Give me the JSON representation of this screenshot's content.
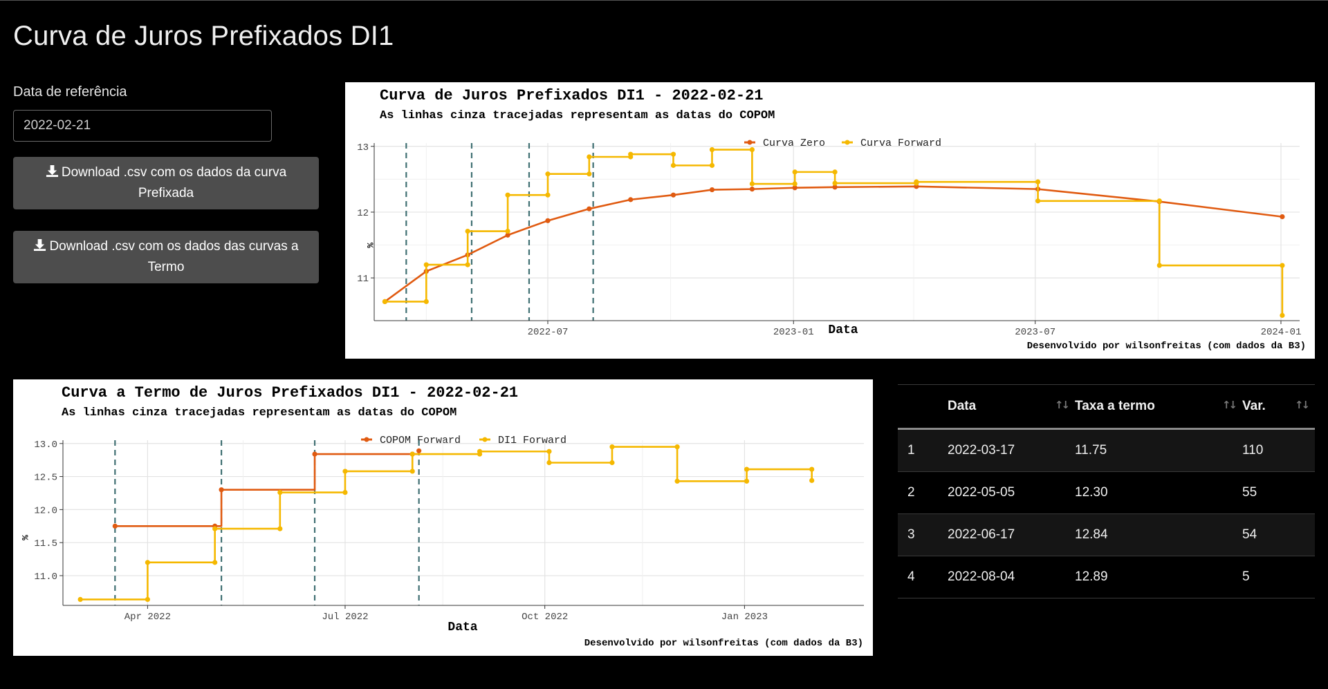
{
  "page": {
    "title": "Curva de Juros Prefixados DI1"
  },
  "sidebar": {
    "ref_label": "Data de referência",
    "ref_date_value": "2022-02-21",
    "download_curve_label": "Download .csv com os dados da curva Prefixada",
    "download_forward_label": "Download .csv com os dados das curvas a Termo"
  },
  "plot1": {
    "title": "Curva de Juros Prefixados DI1 - 2022-02-21",
    "subtitle": "As linhas cinza tracejadas representam as datas do COPOM",
    "legend": [
      "Curva Zero",
      "Curva Forward"
    ],
    "xlabel": "Data",
    "ylabel": "%",
    "caption": "Desenvolvido por wilsonfreitas (com dados da B3)",
    "xticks": [
      "2022-07",
      "2023-01",
      "2023-07",
      "2024-01"
    ],
    "yticks": [
      "11",
      "12",
      "13"
    ]
  },
  "plot2": {
    "title": "Curva a Termo de Juros Prefixados DI1 - 2022-02-21",
    "subtitle": "As linhas cinza tracejadas representam as datas do COPOM",
    "legend": [
      "COPOM Forward",
      "DI1 Forward"
    ],
    "xlabel": "Data",
    "ylabel": "%",
    "caption": "Desenvolvido por wilsonfreitas (com dados da B3)",
    "xticks": [
      "Apr 2022",
      "Jul 2022",
      "Oct 2022",
      "Jan 2023"
    ],
    "yticks": [
      "11.0",
      "11.5",
      "12.0",
      "12.5",
      "13.0"
    ]
  },
  "chart_data": [
    {
      "type": "line",
      "title": "Curva de Juros Prefixados DI1 - 2022-02-21",
      "subtitle": "As linhas cinza tracejadas representam as datas do COPOM",
      "xlabel": "Data",
      "ylabel": "%",
      "xlim": [
        "2022-02-21",
        "2024-01-15"
      ],
      "ylim": [
        10.35,
        13.05
      ],
      "legend_position": "top",
      "grid": true,
      "copom_dates": [
        "2022-03-17",
        "2022-05-05",
        "2022-06-17",
        "2022-08-04"
      ],
      "series": [
        {
          "name": "Curva Zero",
          "color": "#E05A10",
          "step": false,
          "x": [
            "2022-03-01",
            "2022-04-01",
            "2022-05-02",
            "2022-06-01",
            "2022-07-01",
            "2022-08-01",
            "2022-09-01",
            "2022-10-03",
            "2022-11-01",
            "2022-12-01",
            "2023-01-02",
            "2023-02-01",
            "2023-04-03",
            "2023-07-03",
            "2023-10-02",
            "2024-01-02"
          ],
          "y": [
            10.64,
            11.1,
            11.35,
            11.65,
            11.87,
            12.05,
            12.19,
            12.26,
            12.34,
            12.35,
            12.37,
            12.38,
            12.39,
            12.35,
            12.16,
            11.93
          ]
        },
        {
          "name": "Curva Forward",
          "color": "#F5B800",
          "step": true,
          "x": [
            "2022-03-01",
            "2022-04-01",
            "2022-05-02",
            "2022-06-01",
            "2022-07-01",
            "2022-08-01",
            "2022-09-01",
            "2022-10-03",
            "2022-11-01",
            "2022-12-01",
            "2023-01-02",
            "2023-02-01",
            "2023-04-03",
            "2023-07-03",
            "2023-10-02",
            "2024-01-02"
          ],
          "y": [
            10.64,
            11.2,
            11.71,
            12.26,
            12.58,
            12.84,
            12.88,
            12.71,
            12.95,
            12.43,
            12.61,
            12.44,
            12.46,
            12.17,
            11.19,
            10.43
          ]
        }
      ]
    },
    {
      "type": "line",
      "title": "Curva a Termo de Juros Prefixados DI1 - 2022-02-21",
      "subtitle": "As linhas cinza tracejadas representam as datas do COPOM",
      "xlabel": "Data",
      "ylabel": "%",
      "xlim": [
        "2022-02-21",
        "2023-02-25"
      ],
      "ylim": [
        10.55,
        13.05
      ],
      "legend_position": "top",
      "grid": true,
      "copom_dates": [
        "2022-03-17",
        "2022-05-05",
        "2022-06-17",
        "2022-08-04"
      ],
      "series": [
        {
          "name": "COPOM Forward",
          "color": "#E05A10",
          "step": true,
          "x": [
            "2022-03-17",
            "2022-05-05",
            "2022-06-17",
            "2022-08-04"
          ],
          "end": "2022-08-04",
          "points_x": [
            "2022-03-17",
            "2022-05-02",
            "2022-05-05",
            "2022-06-17",
            "2022-08-01",
            "2022-08-04"
          ],
          "points_y": [
            11.75,
            11.75,
            12.3,
            12.84,
            12.84,
            12.89
          ],
          "y": [
            11.75,
            12.3,
            12.84,
            12.89
          ]
        },
        {
          "name": "DI1 Forward",
          "color": "#F5B800",
          "step": true,
          "x": [
            "2022-03-01",
            "2022-04-01",
            "2022-05-02",
            "2022-06-01",
            "2022-07-01",
            "2022-08-01",
            "2022-09-01",
            "2022-10-03",
            "2022-11-01",
            "2022-12-01",
            "2023-01-02",
            "2023-02-01"
          ],
          "y": [
            10.64,
            11.2,
            11.71,
            12.26,
            12.58,
            12.84,
            12.88,
            12.71,
            12.95,
            12.43,
            12.61,
            12.44
          ]
        }
      ]
    }
  ],
  "table": {
    "headers": [
      "",
      "Data",
      "Taxa a termo",
      "Var."
    ],
    "rows": [
      {
        "idx": "1",
        "data": "2022-03-17",
        "taxa": "11.75",
        "var": "110"
      },
      {
        "idx": "2",
        "data": "2022-05-05",
        "taxa": "12.30",
        "var": "55"
      },
      {
        "idx": "3",
        "data": "2022-06-17",
        "taxa": "12.84",
        "var": "54"
      },
      {
        "idx": "4",
        "data": "2022-08-04",
        "taxa": "12.89",
        "var": "5"
      }
    ]
  },
  "colors": {
    "zero": "#E05A10",
    "forward": "#F5B800",
    "copom_line": "#3F6F72",
    "grid": "#E5E5E5"
  }
}
